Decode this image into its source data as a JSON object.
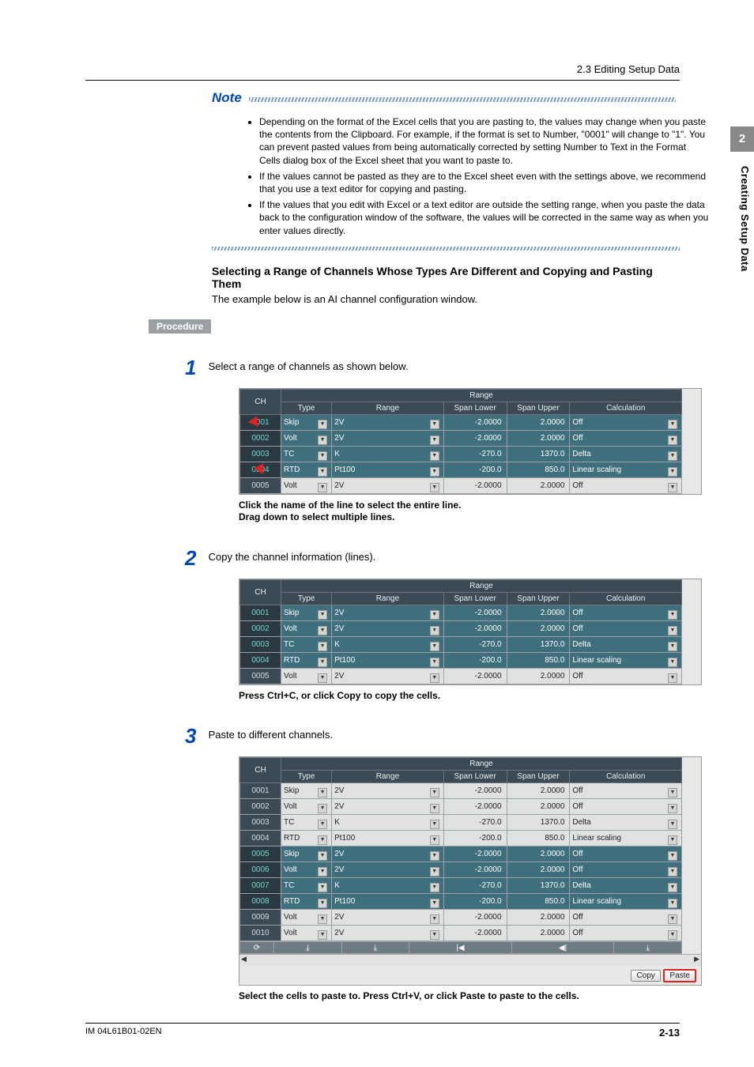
{
  "section_number_tab": "2",
  "section_side_label": "Creating Setup Data",
  "header_breadcrumb": "2.3  Editing Setup Data",
  "note_label": "Note",
  "note_bullets": [
    "Depending on the format of the Excel cells that you are pasting to, the values may change when you paste the contents from the Clipboard. For example, if the format is set to Number, \"0001\" will change to \"1\". You can prevent pasted values from being automatically corrected by setting Number to Text in the Format Cells dialog box of the Excel sheet that you want to paste to.",
    "If the values cannot be pasted as they are to the Excel sheet even with the settings above, we recommend that you use a text editor for copying and pasting.",
    "If the values that you edit with Excel or a text editor are outside the setting range, when you paste the data back to the configuration window of the software, the values will be corrected in the same way as when you enter values directly."
  ],
  "heading_1": "Selecting a Range of Channels Whose Types Are Different and Copying and Pasting Them",
  "heading_1_sub": "The example below is an AI channel configuration window.",
  "procedure_label": "Procedure",
  "steps": {
    "s1": {
      "num": "1",
      "text": "Select a range of channels as shown below."
    },
    "s2": {
      "num": "2",
      "text": "Copy the channel information (lines)."
    },
    "s3": {
      "num": "3",
      "text": "Paste to different channels."
    }
  },
  "captions": {
    "c1a": "Click the name of the line to select the entire line.",
    "c1b": "Drag down to select multiple lines.",
    "c2": "Press Ctrl+C, or click Copy to copy the cells.",
    "c3": "Select the cells to paste to. Press Ctrl+V, or click Paste to paste to the cells."
  },
  "table_headers": {
    "ch": "CH",
    "range_group": "Range",
    "type": "Type",
    "range": "Range",
    "span_lower": "Span Lower",
    "span_upper": "Span Upper",
    "calc": "Calculation"
  },
  "table1_rows": [
    {
      "ch": "0001",
      "type": "Skip",
      "range": "2V",
      "lower": "-2.0000",
      "upper": "2.0000",
      "calc": "Off",
      "sel": true
    },
    {
      "ch": "0002",
      "type": "Volt",
      "range": "2V",
      "lower": "-2.0000",
      "upper": "2.0000",
      "calc": "Off",
      "sel": true
    },
    {
      "ch": "0003",
      "type": "TC",
      "range": "K",
      "lower": "-270.0",
      "upper": "1370.0",
      "calc": "Delta",
      "sel": true
    },
    {
      "ch": "0004",
      "type": "RTD",
      "range": "Pt100",
      "lower": "-200.0",
      "upper": "850.0",
      "calc": "Linear scaling",
      "sel": true
    },
    {
      "ch": "0005",
      "type": "Volt",
      "range": "2V",
      "lower": "-2.0000",
      "upper": "2.0000",
      "calc": "Off",
      "sel": false
    }
  ],
  "table2_rows": [
    {
      "ch": "0001",
      "type": "Skip",
      "range": "2V",
      "lower": "-2.0000",
      "upper": "2.0000",
      "calc": "Off",
      "sel": true
    },
    {
      "ch": "0002",
      "type": "Volt",
      "range": "2V",
      "lower": "-2.0000",
      "upper": "2.0000",
      "calc": "Off",
      "sel": true
    },
    {
      "ch": "0003",
      "type": "TC",
      "range": "K",
      "lower": "-270.0",
      "upper": "1370.0",
      "calc": "Delta",
      "sel": true
    },
    {
      "ch": "0004",
      "type": "RTD",
      "range": "Pt100",
      "lower": "-200.0",
      "upper": "850.0",
      "calc": "Linear scaling",
      "sel": true
    },
    {
      "ch": "0005",
      "type": "Volt",
      "range": "2V",
      "lower": "-2.0000",
      "upper": "2.0000",
      "calc": "Off",
      "sel": false
    }
  ],
  "table3_rows": [
    {
      "ch": "0001",
      "type": "Skip",
      "range": "2V",
      "lower": "-2.0000",
      "upper": "2.0000",
      "calc": "Off",
      "sel": false
    },
    {
      "ch": "0002",
      "type": "Volt",
      "range": "2V",
      "lower": "-2.0000",
      "upper": "2.0000",
      "calc": "Off",
      "sel": false
    },
    {
      "ch": "0003",
      "type": "TC",
      "range": "K",
      "lower": "-270.0",
      "upper": "1370.0",
      "calc": "Delta",
      "sel": false
    },
    {
      "ch": "0004",
      "type": "RTD",
      "range": "Pt100",
      "lower": "-200.0",
      "upper": "850.0",
      "calc": "Linear scaling",
      "sel": false
    },
    {
      "ch": "0005",
      "type": "Skip",
      "range": "2V",
      "lower": "-2.0000",
      "upper": "2.0000",
      "calc": "Off",
      "sel": true
    },
    {
      "ch": "0006",
      "type": "Volt",
      "range": "2V",
      "lower": "-2.0000",
      "upper": "2.0000",
      "calc": "Off",
      "sel": true
    },
    {
      "ch": "0007",
      "type": "TC",
      "range": "K",
      "lower": "-270.0",
      "upper": "1370.0",
      "calc": "Delta",
      "sel": true
    },
    {
      "ch": "0008",
      "type": "RTD",
      "range": "Pt100",
      "lower": "-200.0",
      "upper": "850.0",
      "calc": "Linear scaling",
      "sel": true
    },
    {
      "ch": "0009",
      "type": "Volt",
      "range": "2V",
      "lower": "-2.0000",
      "upper": "2.0000",
      "calc": "Off",
      "sel": false
    },
    {
      "ch": "0010",
      "type": "Volt",
      "range": "2V",
      "lower": "-2.0000",
      "upper": "2.0000",
      "calc": "Off",
      "sel": false
    }
  ],
  "buttons": {
    "copy": "Copy",
    "paste": "Paste"
  },
  "footer": {
    "left": "IM 04L61B01-02EN",
    "right": "2-13"
  },
  "nav_icons": {
    "refresh": "⟳",
    "down": "⤓",
    "first": "|◀",
    "prev": "◀|"
  }
}
